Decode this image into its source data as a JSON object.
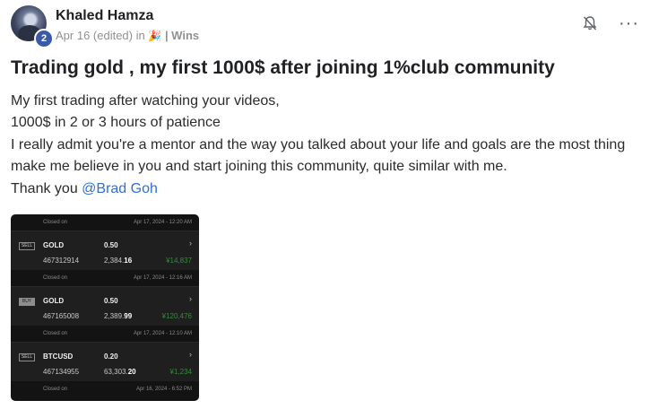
{
  "post": {
    "author": "Khaled Hamza",
    "level": "2",
    "meta_date": "Apr 16 (edited) in",
    "meta_emoji": "🎉",
    "meta_category": "| Wins",
    "more_label": "···",
    "title": "Trading gold , my first 1000$ after joining 1%club community",
    "body_lines": [
      "My first trading after watching your videos,",
      "1000$ in 2 or 3 hours of patience",
      "I really admit you're a mentor and the way you talked about your life and goals are the most thing",
      "make me believe in you and start joining this community, quite similar with me."
    ],
    "thanks_prefix": "Thank you ",
    "mention": "@Brad Goh"
  },
  "screenshot": {
    "top_closed": {
      "label": "Closed on",
      "date": "Apr 17, 2024 - 12:20 AM"
    },
    "trades": [
      {
        "side": "SELL",
        "symbol": "GOLD",
        "lot": "0.50",
        "chevron": "›",
        "id": "467312914",
        "price_main": "2,384.",
        "price_bold": "16",
        "pnl": "¥14,837",
        "closed_label": "Closed on",
        "closed_date": "Apr 17, 2024 - 12:16 AM"
      },
      {
        "side": "BUY",
        "symbol": "GOLD",
        "lot": "0.50",
        "chevron": "›",
        "id": "467165008",
        "price_main": "2,389.",
        "price_bold": "99",
        "pnl": "¥120,476",
        "closed_label": "Closed on",
        "closed_date": "Apr 17, 2024 - 12:10 AM"
      },
      {
        "side": "SELL",
        "symbol": "BTCUSD",
        "lot": "0.20",
        "chevron": "›",
        "id": "467134955",
        "price_main": "63,303.",
        "price_bold": "20",
        "pnl": "¥1,234",
        "closed_label": "Closed on",
        "closed_date": "Apr 16, 2024 - 6:52 PM"
      }
    ]
  },
  "colors": {
    "mention": "#2f6fd6",
    "profit": "#2f8f3a",
    "level_badge": "#3a5aa8"
  }
}
